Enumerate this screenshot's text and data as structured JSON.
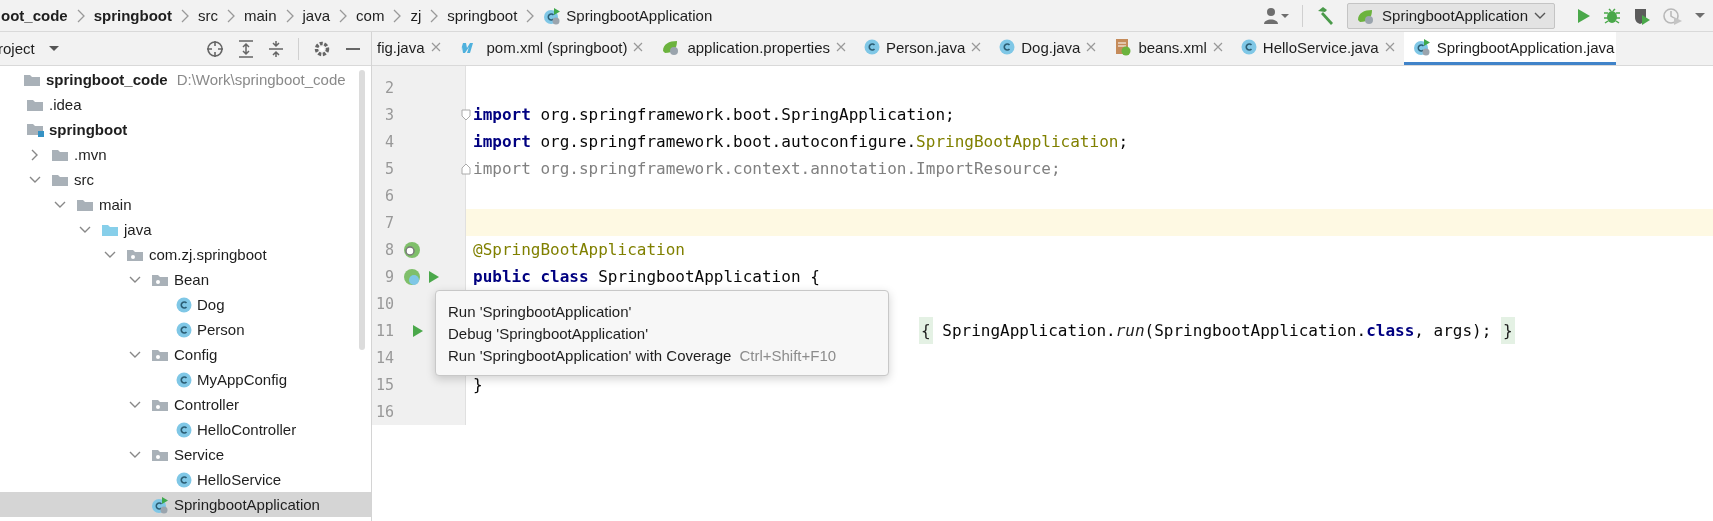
{
  "breadcrumbs": [
    {
      "label": "oot_code",
      "kind": "project"
    },
    {
      "label": "springboot",
      "kind": "module"
    },
    {
      "label": "src",
      "kind": "folder"
    },
    {
      "label": "main",
      "kind": "folder"
    },
    {
      "label": "java",
      "kind": "folder"
    },
    {
      "label": "com",
      "kind": "folder"
    },
    {
      "label": "zj",
      "kind": "folder"
    },
    {
      "label": "springboot",
      "kind": "folder"
    },
    {
      "label": "SpringbootApplication",
      "kind": "app"
    }
  ],
  "run_config": {
    "label": "SpringbootApplication"
  },
  "project_panel": {
    "title": "roject"
  },
  "tabs": [
    {
      "label": "fig.java",
      "kind": "plain",
      "selected": false
    },
    {
      "label": "pom.xml (springboot)",
      "kind": "maven",
      "selected": false
    },
    {
      "label": "application.properties",
      "kind": "properties",
      "selected": false
    },
    {
      "label": "Person.java",
      "kind": "class",
      "selected": false
    },
    {
      "label": "Dog.java",
      "kind": "class",
      "selected": false
    },
    {
      "label": "beans.xml",
      "kind": "xml",
      "selected": false
    },
    {
      "label": "HelloService.java",
      "kind": "class",
      "selected": false
    },
    {
      "label": "SpringbootApplication.java",
      "kind": "app",
      "selected": true
    }
  ],
  "tree": [
    {
      "label": "springboot_code",
      "kind": "project",
      "note": "D:\\Work\\springboot_code",
      "selected": false,
      "children": [
        {
          "label": ".idea",
          "kind": "folder",
          "selected": false
        },
        {
          "label": "springboot",
          "kind": "module",
          "selected": false,
          "children": [
            {
              "label": ".mvn",
              "kind": "folder",
              "expanded": false,
              "selected": false
            },
            {
              "label": "src",
              "kind": "folder",
              "expanded": true,
              "selected": false,
              "children": [
                {
                  "label": "main",
                  "kind": "folder",
                  "expanded": true,
                  "selected": false,
                  "children": [
                    {
                      "label": "java",
                      "kind": "source",
                      "expanded": true,
                      "selected": false,
                      "children": [
                        {
                          "label": "com.zj.springboot",
                          "kind": "package",
                          "expanded": true,
                          "selected": false,
                          "children": [
                            {
                              "label": "Bean",
                              "kind": "package",
                              "expanded": true,
                              "selected": false,
                              "children": [
                                {
                                  "label": "Dog",
                                  "kind": "class",
                                  "selected": false
                                },
                                {
                                  "label": "Person",
                                  "kind": "class",
                                  "selected": false
                                }
                              ]
                            },
                            {
                              "label": "Config",
                              "kind": "package",
                              "expanded": true,
                              "selected": false,
                              "children": [
                                {
                                  "label": "MyAppConfig",
                                  "kind": "class",
                                  "selected": false
                                }
                              ]
                            },
                            {
                              "label": "Controller",
                              "kind": "package",
                              "expanded": true,
                              "selected": false,
                              "children": [
                                {
                                  "label": "HelloController",
                                  "kind": "class",
                                  "selected": false
                                }
                              ]
                            },
                            {
                              "label": "Service",
                              "kind": "package",
                              "expanded": true,
                              "selected": false,
                              "children": [
                                {
                                  "label": "HelloService",
                                  "kind": "class",
                                  "selected": false
                                }
                              ]
                            },
                            {
                              "label": "SpringbootApplication",
                              "kind": "app",
                              "selected": true
                            }
                          ]
                        }
                      ]
                    }
                  ]
                }
              ]
            }
          ]
        }
      ]
    }
  ],
  "code_lines": [
    {
      "number": "2",
      "kind": "code"
    },
    {
      "number": "3",
      "kind": "code",
      "marks": [
        {
          "kind": "fold-start"
        }
      ],
      "tokens": [
        {
          "text": "import",
          "kind": "keyword"
        },
        {
          "text": " org.springframework.boot.SpringApplication;",
          "kind": "plain"
        }
      ]
    },
    {
      "number": "4",
      "kind": "code",
      "tokens": [
        {
          "text": "import",
          "kind": "keyword"
        },
        {
          "text": " org.springframework.boot.autoconfigure.",
          "kind": "plain"
        },
        {
          "text": "SpringBootApplication",
          "kind": "annotation"
        },
        {
          "text": ";",
          "kind": "plain"
        }
      ]
    },
    {
      "number": "5",
      "kind": "code",
      "marks": [
        {
          "kind": "fold-end"
        }
      ],
      "tokens": [
        {
          "text": "import org.springframework.context.annotation.ImportResource;",
          "kind": "unused"
        }
      ]
    },
    {
      "number": "6",
      "kind": "code"
    },
    {
      "number": "7",
      "kind": "current"
    },
    {
      "number": "8",
      "kind": "code",
      "marks": [
        {
          "kind": "bean"
        }
      ],
      "tokens": [
        {
          "text": "@SpringBootApplication",
          "kind": "annotation"
        }
      ]
    },
    {
      "number": "9",
      "kind": "code",
      "marks": [
        {
          "kind": "spring"
        },
        {
          "kind": "run"
        }
      ],
      "tokens": [
        {
          "text": "public class",
          "kind": "keyword"
        },
        {
          "text": " SpringbootApplication {",
          "kind": "plain"
        }
      ]
    },
    {
      "number": "10",
      "kind": "code"
    },
    {
      "number": "11",
      "kind": "covered",
      "marks": [
        {
          "kind": "run"
        }
      ],
      "tokens": [
        {
          "text": "{",
          "kind": "fold"
        },
        {
          "text": " SpringApplication.",
          "kind": "plain"
        },
        {
          "text": "run",
          "kind": "static"
        },
        {
          "text": "(SpringbootApplication.",
          "kind": "plain"
        },
        {
          "text": "class",
          "kind": "keyword"
        },
        {
          "text": ", args); ",
          "kind": "plain"
        },
        {
          "text": "}",
          "kind": "fold"
        }
      ]
    },
    {
      "number": "14",
      "kind": "code"
    },
    {
      "number": "15",
      "kind": "code",
      "tokens": [
        {
          "text": "}",
          "kind": "plain"
        }
      ]
    },
    {
      "number": "16",
      "kind": "code"
    }
  ],
  "popup": {
    "items": [
      {
        "label": "Run 'SpringbootApplication'"
      },
      {
        "label": "Debug 'SpringbootApplication'"
      },
      {
        "label": "Run 'SpringbootApplication' with Coverage",
        "shortcut": "Ctrl+Shift+F10"
      }
    ]
  }
}
